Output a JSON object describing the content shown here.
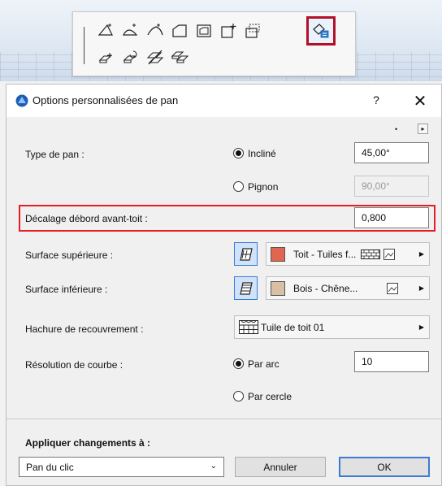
{
  "dialog": {
    "title": "Options personnalisées de pan",
    "help_label": "?",
    "close_label": "✕",
    "expand_glyph": "▸"
  },
  "fields": {
    "type_label": "Type de pan :",
    "incline_label": "Incliné",
    "incline_value": "45,00°",
    "pignon_label": "Pignon",
    "pignon_value": "90,00°",
    "decalage_label": "Décalage débord avant-toit :",
    "decalage_value": "0,800",
    "surface_sup_label": "Surface supérieure :",
    "surface_sup_value": "Toit - Tuiles f...",
    "surface_sup_color": "#e06651",
    "surface_inf_label": "Surface inférieure :",
    "surface_inf_value": "Bois - Chêne...",
    "surface_inf_color": "#d8c1a3",
    "hachure_label": "Hachure de recouvrement :",
    "hachure_value": "Tuile de toit 01",
    "resolution_label": "Résolution de courbe :",
    "par_arc_label": "Par arc",
    "par_arc_value": "10",
    "par_cercle_label": "Par cercle"
  },
  "footer": {
    "apply_label": "Appliquer changements à :",
    "apply_value": "Pan du clic",
    "cancel_label": "Annuler",
    "ok_label": "OK"
  },
  "colors": {
    "highlight": "#e31e24",
    "selected_tool_border": "#b2102a",
    "accent": "#3c7bd1"
  }
}
